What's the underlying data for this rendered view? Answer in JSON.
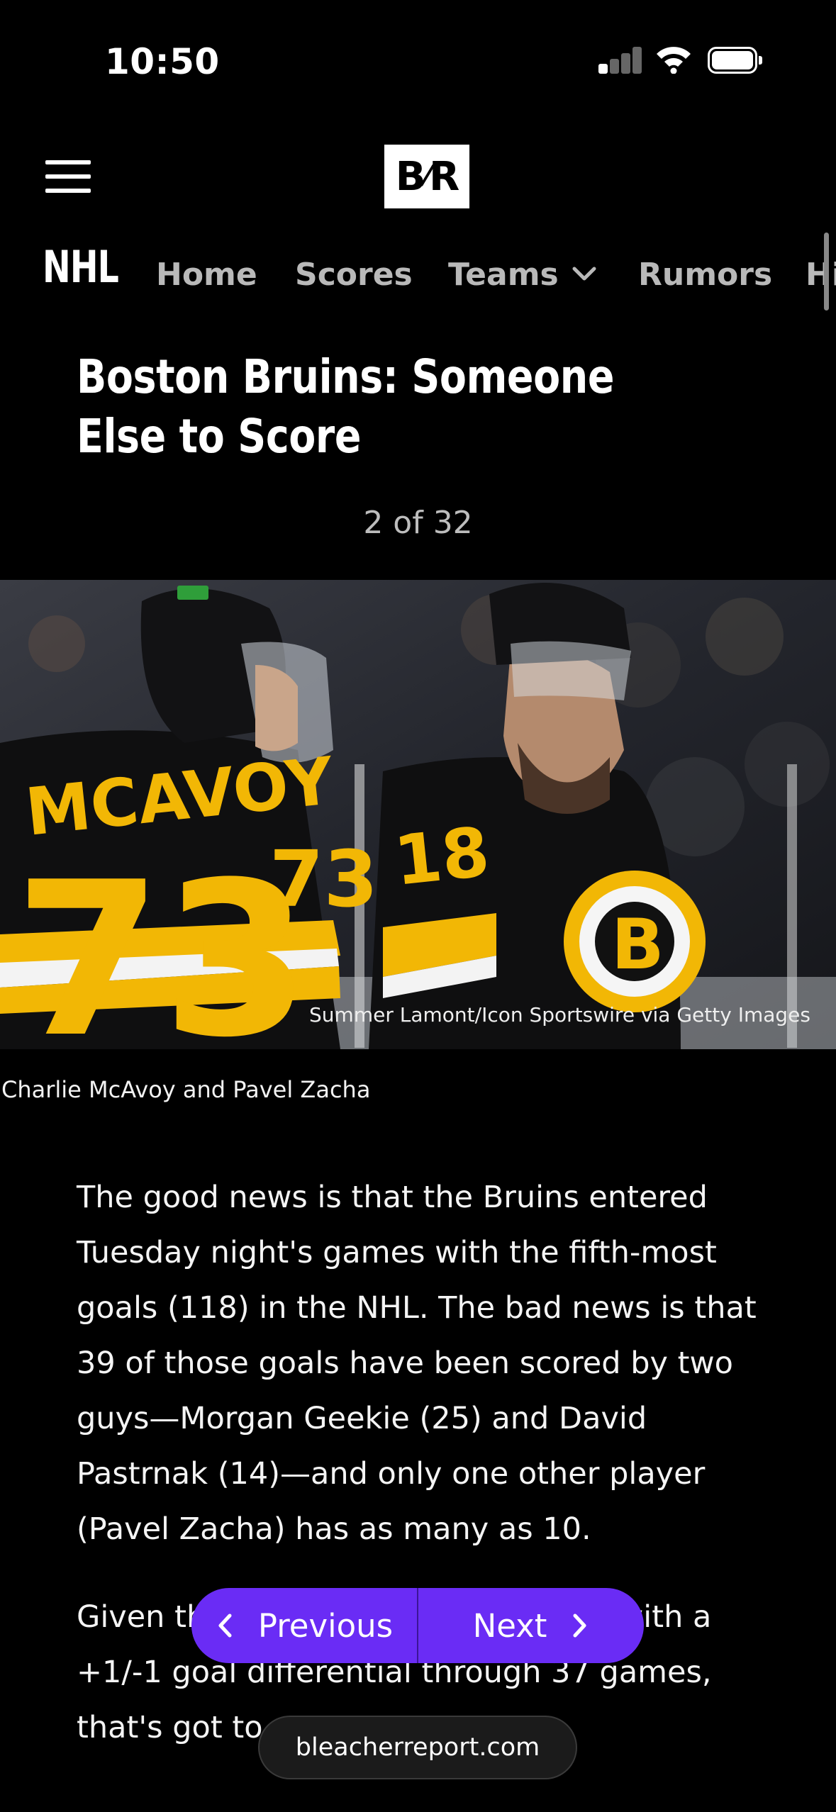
{
  "status_bar": {
    "time": "10:50"
  },
  "header": {
    "logo_text_left": "B",
    "logo_text_right": "R"
  },
  "nav": {
    "league": "NHL",
    "items": [
      "Home",
      "Scores",
      "Teams",
      "Rumors",
      "Hi"
    ]
  },
  "article": {
    "headline": "Boston Bruins: Someone Else to Score",
    "pager": "2 of 32",
    "photo_credit": "Summer Lamont/Icon Sportswire via Getty Images",
    "caption": "Charlie McAvoy and Pavel Zacha",
    "paragraphs": [
      "The good news is that the Bruins entered Tuesday night's games with the fifth-most goals (118) in the NHL. The bad news is that 39 of those goals have been scored by two guys—Morgan Geekie (25) and David Pastrnak (14)—and only one other player (Pavel Zacha) has as many as 10.",
      "Given the Bruins entered the week with a +1/-1 goal differential through 37 games, that's got to"
    ],
    "jersey_left_name": "MCAVOY",
    "jersey_left_number": "73",
    "jersey_right_number": "18"
  },
  "controls": {
    "previous_label": "Previous",
    "next_label": "Next"
  },
  "browser": {
    "url": "bleacherreport.com"
  }
}
